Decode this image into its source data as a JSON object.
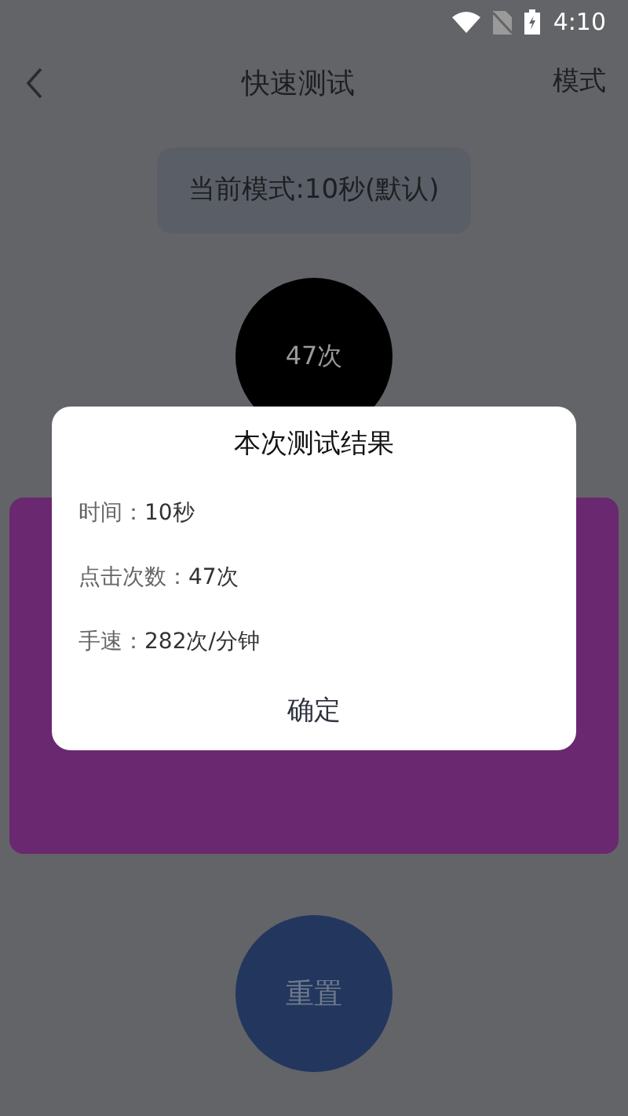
{
  "status_bar": {
    "time": "4:10"
  },
  "header": {
    "title": "快速测试",
    "action": "模式"
  },
  "mode_label": "当前模式:10秒(默认)",
  "counter": "47次",
  "reset_button": "重置",
  "dialog": {
    "title": "本次测试结果",
    "rows": [
      {
        "label": "时间：",
        "value": "10秒"
      },
      {
        "label": "点击次数：",
        "value": "47次"
      },
      {
        "label": "手速：",
        "value": "282次/分钟"
      }
    ],
    "button": "确定"
  }
}
